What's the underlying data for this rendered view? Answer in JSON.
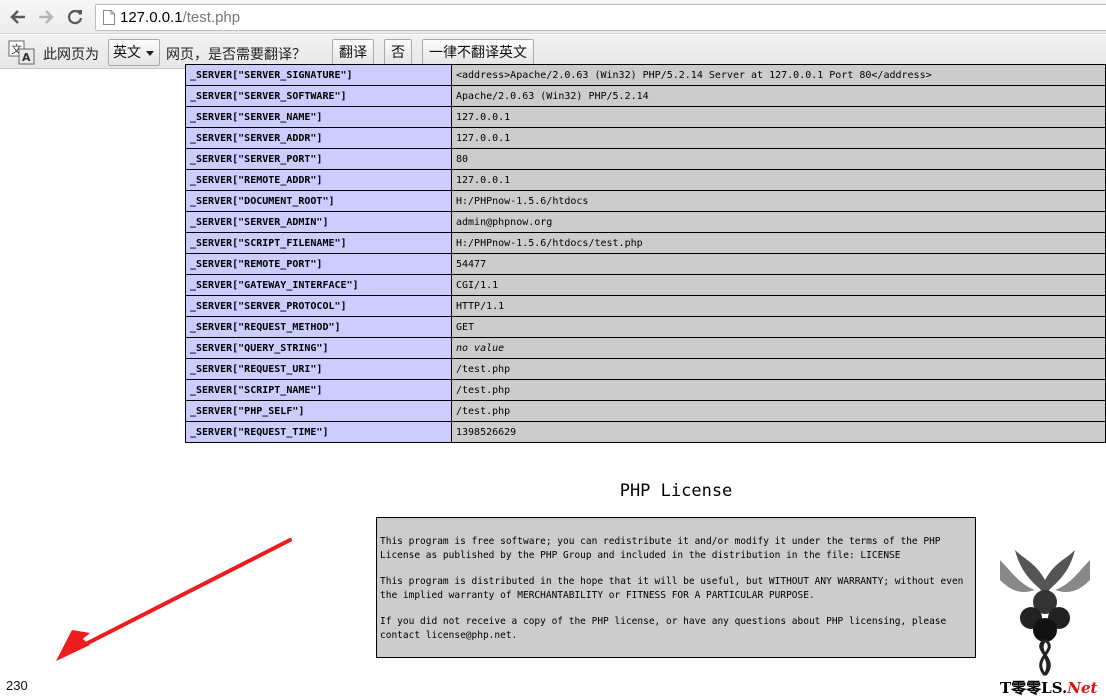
{
  "browser": {
    "url_host": "127.0.0.1",
    "url_path": "/test.php"
  },
  "translate_bar": {
    "prompt_prefix": "此网页为",
    "language": "英文",
    "prompt_suffix": "网页，是否需要翻译？",
    "translate_button": "翻译",
    "no_button": "否",
    "never_button": "一律不翻译英文"
  },
  "server_rows": [
    {
      "key": "_SERVER[\"SERVER_SIGNATURE\"]",
      "value": "<address>Apache/2.0.63 (Win32) PHP/5.2.14 Server at 127.0.0.1 Port 80</address>"
    },
    {
      "key": "_SERVER[\"SERVER_SOFTWARE\"]",
      "value": "Apache/2.0.63 (Win32) PHP/5.2.14"
    },
    {
      "key": "_SERVER[\"SERVER_NAME\"]",
      "value": "127.0.0.1"
    },
    {
      "key": "_SERVER[\"SERVER_ADDR\"]",
      "value": "127.0.0.1"
    },
    {
      "key": "_SERVER[\"SERVER_PORT\"]",
      "value": "80"
    },
    {
      "key": "_SERVER[\"REMOTE_ADDR\"]",
      "value": "127.0.0.1"
    },
    {
      "key": "_SERVER[\"DOCUMENT_ROOT\"]",
      "value": "H:/PHPnow-1.5.6/htdocs"
    },
    {
      "key": "_SERVER[\"SERVER_ADMIN\"]",
      "value": "admin@phpnow.org"
    },
    {
      "key": "_SERVER[\"SCRIPT_FILENAME\"]",
      "value": "H:/PHPnow-1.5.6/htdocs/test.php"
    },
    {
      "key": "_SERVER[\"REMOTE_PORT\"]",
      "value": "54477"
    },
    {
      "key": "_SERVER[\"GATEWAY_INTERFACE\"]",
      "value": "CGI/1.1"
    },
    {
      "key": "_SERVER[\"SERVER_PROTOCOL\"]",
      "value": "HTTP/1.1"
    },
    {
      "key": "_SERVER[\"REQUEST_METHOD\"]",
      "value": "GET"
    },
    {
      "key": "_SERVER[\"QUERY_STRING\"]",
      "value": "no value",
      "italic": true
    },
    {
      "key": "_SERVER[\"REQUEST_URI\"]",
      "value": "/test.php"
    },
    {
      "key": "_SERVER[\"SCRIPT_NAME\"]",
      "value": "/test.php"
    },
    {
      "key": "_SERVER[\"PHP_SELF\"]",
      "value": "/test.php"
    },
    {
      "key": "_SERVER[\"REQUEST_TIME\"]",
      "value": "1398526629"
    }
  ],
  "license": {
    "title": "PHP License",
    "paragraphs": [
      "This program is free software; you can redistribute it and/or modify it under the terms of the PHP License as published by the PHP Group and included in the distribution in the file: LICENSE",
      "This program is distributed in the hope that it will be useful, but WITHOUT ANY WARRANTY; without even the implied warranty of MERCHANTABILITY or FITNESS FOR A PARTICULAR PURPOSE.",
      "If you did not receive a copy of the PHP license, or have any questions about PHP licensing, please contact license@php.net."
    ]
  },
  "counter": "230",
  "watermark": {
    "main": "T零零LS.",
    "suffix": "Net"
  },
  "colors": {
    "key_cell": "#ccccff",
    "value_cell": "#cccccc",
    "arrow": "#ee1c1c"
  }
}
